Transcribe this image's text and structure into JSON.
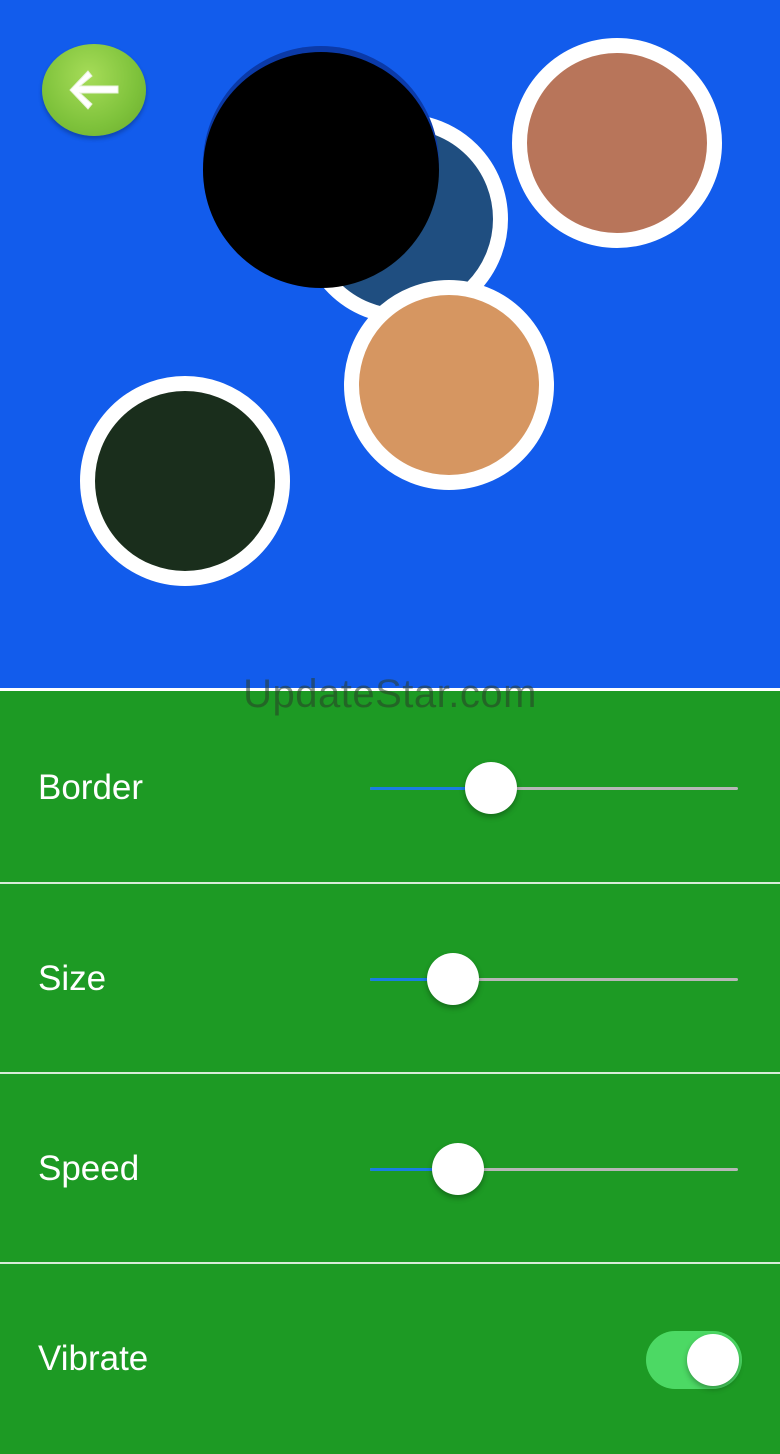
{
  "canvas": {
    "background": "#125cec",
    "back_icon": "arrow-left-icon",
    "bubbles": [
      {
        "name": "bubble-brown",
        "color": "#b8755a"
      },
      {
        "name": "bubble-navy",
        "color": "#1f4e80"
      },
      {
        "name": "bubble-orange",
        "color": "#d69661"
      },
      {
        "name": "bubble-dark-green",
        "color": "#1a2e1c"
      },
      {
        "name": "bubble-black",
        "color": "#000000"
      }
    ]
  },
  "watermark": "UpdateStar.com",
  "settings": {
    "border": {
      "label": "Border",
      "value": 0.33
    },
    "size": {
      "label": "Size",
      "value": 0.225
    },
    "speed": {
      "label": "Speed",
      "value": 0.24
    },
    "vibrate": {
      "label": "Vibrate",
      "on": true
    }
  },
  "colors": {
    "settings_background": "#1d9a24",
    "slider_fill": "#1a7de2",
    "toggle_on": "#4cd964"
  }
}
